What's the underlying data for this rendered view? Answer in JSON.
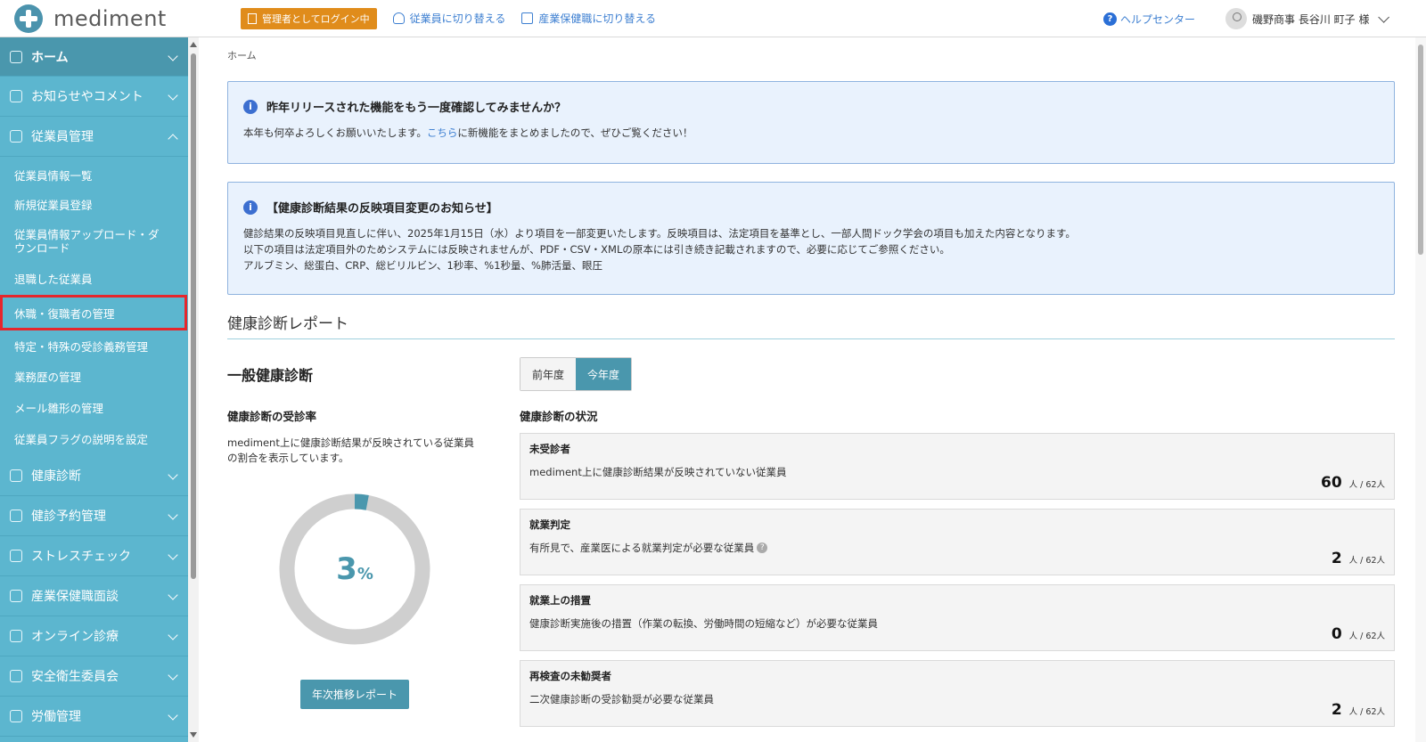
{
  "header": {
    "logo_text": "mediment",
    "admin_badge": "管理者としてログイン中",
    "switch_employee": "従業員に切り替える",
    "switch_occupational": "産業保健職に切り替える",
    "help_center": "ヘルプセンター",
    "user_name": "磯野商事 長谷川 町子 様"
  },
  "sidebar": {
    "items": [
      {
        "label": "ホーム",
        "icon": "home-icon"
      },
      {
        "label": "お知らせやコメント",
        "icon": "bell-icon"
      },
      {
        "label": "従業員管理",
        "icon": "users-icon"
      }
    ],
    "sub_items": [
      "従業員情報一覧",
      "新規従業員登録",
      "従業員情報アップロード・ダウンロード",
      "退職した従業員",
      "休職・復職者の管理",
      "特定・特殊の受診義務管理",
      "業務歴の管理",
      "メール雛形の管理",
      "従業員フラグの説明を設定"
    ],
    "lower_items": [
      {
        "label": "健康診断",
        "icon": "stethoscope-icon"
      },
      {
        "label": "健診予約管理",
        "icon": "stethoscope-icon"
      },
      {
        "label": "ストレスチェック",
        "icon": "heart-icon"
      },
      {
        "label": "産業保健職面談",
        "icon": "interview-icon"
      },
      {
        "label": "オンライン診療",
        "icon": "monitor-icon"
      },
      {
        "label": "安全衛生委員会",
        "icon": "document-icon"
      },
      {
        "label": "労働管理",
        "icon": "calendar-icon"
      }
    ]
  },
  "main": {
    "breadcrumb": "ホーム",
    "notice1": {
      "title": "昨年リリースされた機能をもう一度確認してみませんか？",
      "body_pre": "本年も何卒よろしくお願いいたします。",
      "link": "こちら",
      "body_post": "に新機能をまとめましたので、ぜひご覧ください！"
    },
    "notice2": {
      "title": "【健康診断結果の反映項目変更のお知らせ】",
      "line1": "健診結果の反映項目見直しに伴い、2025年1月15日（水）より項目を一部変更いたします。反映項目は、法定項目を基準とし、一部人間ドック学会の項目も加えた内容となります。",
      "line2": "以下の項目は法定項目外のためシステムには反映されませんが、PDF・CSV・XMLの原本には引き続き記載されますので、必要に応じてご参照ください。",
      "line3": "アルブミン、総蛋白、CRP、総ビリルビン、1秒率、%1秒量、%肺活量、眼圧"
    },
    "section_title": "健康診断レポート",
    "general_title": "一般健康診断",
    "tabs": [
      "前年度",
      "今年度"
    ],
    "active_tab": 1,
    "rate_title": "健康診断の受診率",
    "rate_desc": "mediment上に健康診断結果が反映されている従業員の割合を表示しています。",
    "rate_value": "3",
    "rate_unit": "%",
    "rate_fraction": 0.03,
    "report_button": "年次推移レポート",
    "status_title": "健康診断の状況",
    "cards": [
      {
        "title": "未受診者",
        "desc": "mediment上に健康診断結果が反映されていない従業員",
        "value": "60",
        "total": "人 / 62人"
      },
      {
        "title": "就業判定",
        "desc": "有所見で、産業医による就業判定が必要な従業員",
        "value": "2",
        "total": "人 / 62人"
      },
      {
        "title": "就業上の措置",
        "desc": "健康診断実施後の措置（作業の転換、労働時間の短縮など）が必要な従業員",
        "value": "0",
        "total": "人 / 62人"
      },
      {
        "title": "再検査の未勧奨者",
        "desc": "二次健康診断の受診勧奨が必要な従業員",
        "value": "2",
        "total": "人 / 62人"
      }
    ]
  },
  "colors": {
    "accent": "#4a97ad",
    "sidebar": "#5cb6cf",
    "notice_bg": "#e9f2fd",
    "link": "#3d7fd1",
    "badge": "#e08c1b",
    "selected_outline": "#e6262c"
  }
}
